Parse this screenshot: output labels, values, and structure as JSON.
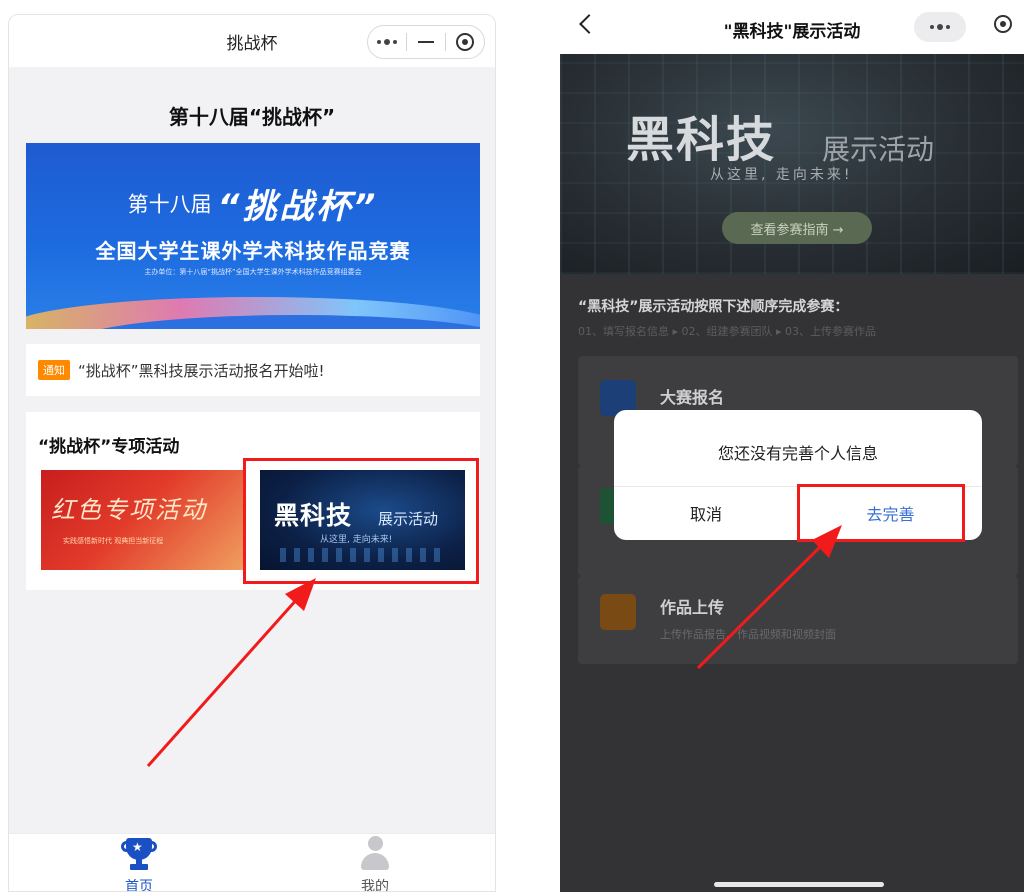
{
  "left": {
    "nav": {
      "title": "挑战杯"
    },
    "page_title": "第十八届“挑战杯”",
    "hero": {
      "line1a": "第十八届",
      "line1b": "“挑战杯”",
      "line2": "全国大学生课外学术科技作品竞赛",
      "line3": "主办单位：第十八届“挑战杯”全国大学生课外学术科技作品竞赛组委会"
    },
    "notice": {
      "tag": "通知",
      "text": "“挑战杯”黑科技展示活动报名开始啦!"
    },
    "special": {
      "title": "“挑战杯”专项活动",
      "card_red": {
        "title": "红色专项活动",
        "subtitle": "实践感悟新时代 观典担当新征程"
      },
      "card_dark": {
        "title": "黑科技",
        "subtitle": "展示活动",
        "slogan": "从这里, 走向未来!"
      }
    },
    "tabbar": {
      "home": "首页",
      "mine": "我的"
    }
  },
  "right": {
    "nav": {
      "title": "\"黑科技\"展示活动"
    },
    "banner": {
      "title": "黑科技",
      "subtitle": "展示活动",
      "slogan": "从这里, 走向未来!",
      "button": "查看参赛指南 →"
    },
    "steps_title": "“黑科技”展示活动按照下述顺序完成参赛：",
    "steps_desc": "01、填写报名信息 ▸ 02、组建参赛团队 ▸ 03、上传参赛作品",
    "cards": [
      {
        "title": "大赛报名",
        "desc": ""
      },
      {
        "title": "",
        "desc": ""
      },
      {
        "title": "作品上传",
        "desc": "上传作品报告、作品视频和视频封面"
      }
    ],
    "dialog": {
      "message": "您还没有完善个人信息",
      "cancel": "取消",
      "confirm": "去完善"
    }
  },
  "colors": {
    "primary_blue": "#1b57c9",
    "highlight_red": "#f21b1b",
    "dialog_confirm": "#3a6fd6",
    "notice_tag": "#ff8a00"
  }
}
